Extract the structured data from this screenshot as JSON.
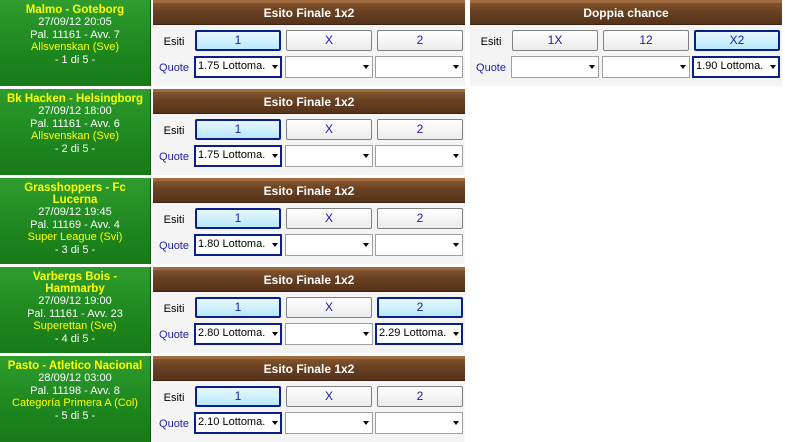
{
  "labels": {
    "esiti": "Esiti",
    "quote": "Quote"
  },
  "events": [
    {
      "title": "Malmo - Goteborg",
      "datetime": "27/09/12 20:05",
      "palinsesto": "Pal. 11161 - Avv. 7",
      "league": "Allsvenskan (Sve)",
      "position": "- 1 di 5 -",
      "markets": [
        {
          "name": "Esito Finale 1x2",
          "outcomes": [
            {
              "label": "1",
              "selected": true,
              "quote": "1.75 Lottoma."
            },
            {
              "label": "X",
              "selected": false,
              "quote": ""
            },
            {
              "label": "2",
              "selected": false,
              "quote": ""
            }
          ]
        },
        {
          "name": "Doppia chance",
          "outcomes": [
            {
              "label": "1X",
              "selected": false,
              "quote": ""
            },
            {
              "label": "12",
              "selected": false,
              "quote": ""
            },
            {
              "label": "X2",
              "selected": true,
              "quote": "1.90 Lottoma."
            }
          ]
        }
      ]
    },
    {
      "title": "Bk Hacken - Helsingborg",
      "datetime": "27/09/12 18:00",
      "palinsesto": "Pal. 11161 - Avv. 6",
      "league": "Allsvenskan (Sve)",
      "position": "- 2 di 5 -",
      "markets": [
        {
          "name": "Esito Finale 1x2",
          "outcomes": [
            {
              "label": "1",
              "selected": true,
              "quote": "1.75 Lottoma."
            },
            {
              "label": "X",
              "selected": false,
              "quote": ""
            },
            {
              "label": "2",
              "selected": false,
              "quote": ""
            }
          ]
        }
      ]
    },
    {
      "title": "Grasshoppers - Fc Lucerna",
      "datetime": "27/09/12 19:45",
      "palinsesto": "Pal. 11169 - Avv. 4",
      "league": "Super League (Svi)",
      "position": "- 3 di 5 -",
      "markets": [
        {
          "name": "Esito Finale 1x2",
          "outcomes": [
            {
              "label": "1",
              "selected": true,
              "quote": "1.80 Lottoma."
            },
            {
              "label": "X",
              "selected": false,
              "quote": ""
            },
            {
              "label": "2",
              "selected": false,
              "quote": ""
            }
          ]
        }
      ]
    },
    {
      "title": "Varbergs Bois - Hammarby",
      "datetime": "27/09/12 19:00",
      "palinsesto": "Pal. 11161 - Avv. 23",
      "league": "Superettan (Sve)",
      "position": "- 4 di 5 -",
      "markets": [
        {
          "name": "Esito Finale 1x2",
          "outcomes": [
            {
              "label": "1",
              "selected": true,
              "quote": "2.80 Lottoma."
            },
            {
              "label": "X",
              "selected": false,
              "quote": ""
            },
            {
              "label": "2",
              "selected": true,
              "quote": "2.29 Lottoma."
            }
          ]
        }
      ]
    },
    {
      "title": "Pasto - Atletico Nacional",
      "datetime": "28/09/12 03:00",
      "palinsesto": "Pal. 11198 - Avv. 8",
      "league": "Categoría Primera A (Col)",
      "position": "- 5 di 5 -",
      "markets": [
        {
          "name": "Esito Finale 1x2",
          "outcomes": [
            {
              "label": "1",
              "selected": true,
              "quote": "2.10 Lottoma."
            },
            {
              "label": "X",
              "selected": false,
              "quote": ""
            },
            {
              "label": "2",
              "selected": false,
              "quote": ""
            }
          ]
        }
      ]
    }
  ]
}
